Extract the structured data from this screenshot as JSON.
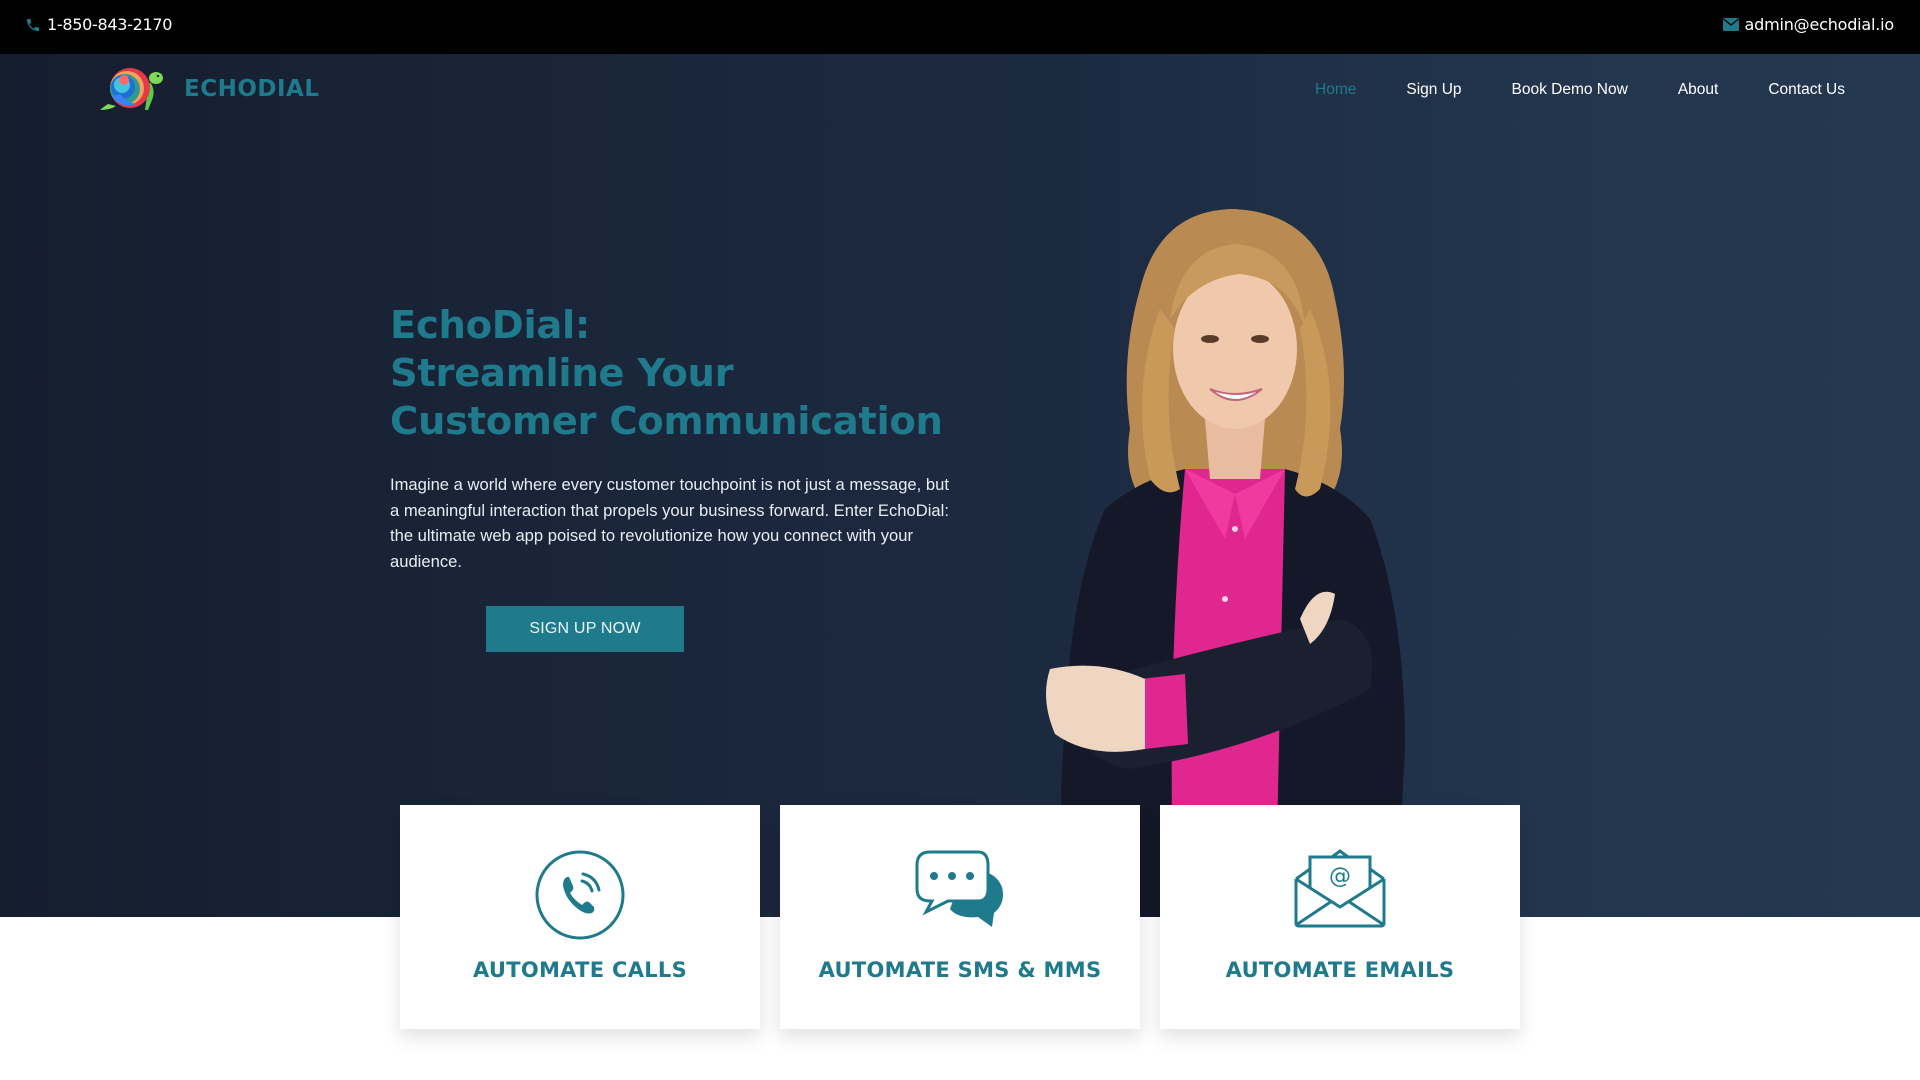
{
  "topbar": {
    "phone": "1-850-843-2170",
    "phone_icon": "phone-icon",
    "email": "admin@echodial.io",
    "email_icon": "envelope-icon"
  },
  "brand": {
    "name": "ECHODIAL",
    "logo_icon": "rainbow-turtle-logo",
    "accent_color": "#1f7a8c"
  },
  "nav": {
    "items": [
      {
        "label": "Home",
        "active": true
      },
      {
        "label": "Sign Up",
        "active": false
      },
      {
        "label": "Book Demo Now",
        "active": false
      },
      {
        "label": "About",
        "active": false
      },
      {
        "label": "Contact Us",
        "active": false
      }
    ]
  },
  "hero": {
    "headline": [
      "EchoDial:",
      "Streamline Your",
      "Customer Communication"
    ],
    "intro_lines": [
      "Imagine a world where every customer touchpoint is not just a message, but",
      "a meaningful interaction that propels your business forward. Enter EchoDial:",
      "the ultimate web app poised to revolutionize how you connect with your",
      "audience."
    ],
    "cta_label": "SIGN UP NOW",
    "image": "smiling-businesswoman-arms-crossed"
  },
  "features": [
    {
      "title": "AUTOMATE CALLS",
      "icon": "phone-call-circle-icon"
    },
    {
      "title": "AUTOMATE SMS & MMS",
      "icon": "chat-bubbles-icon"
    },
    {
      "title": "AUTOMATE EMAILS",
      "icon": "open-envelope-at-icon"
    }
  ]
}
